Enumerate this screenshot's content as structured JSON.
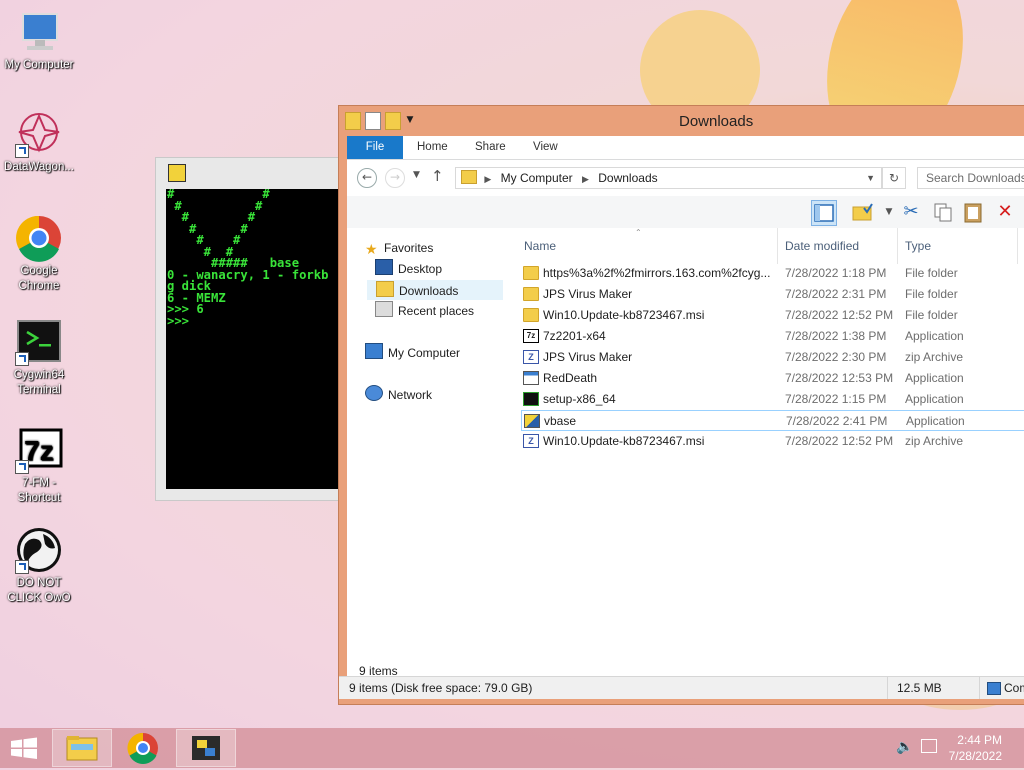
{
  "desktop": {
    "icons": [
      {
        "label": "My Computer",
        "icon": "computer-icon"
      },
      {
        "label": "DataWagon...",
        "icon": "datawagon-icon"
      },
      {
        "label": "Google Chrome",
        "icon": "chrome-icon"
      },
      {
        "label": "Cygwin64 Terminal",
        "icon": "terminal-icon"
      },
      {
        "label": "7-FM - Shortcut",
        "icon": "7zip-icon"
      },
      {
        "label": "DO NOT CLICK OwO",
        "icon": "globe-icon"
      }
    ]
  },
  "console": {
    "lines": [
      "#            #",
      " #          # ",
      "  #        #  ",
      "   #      #   ",
      "    #    #    ",
      "     #  #     ",
      "      #####   base",
      "0 - wanacry, 1 - forkb",
      "g dick",
      "6 - MEMZ",
      ">>> 6",
      ">>>"
    ]
  },
  "explorer": {
    "title": "Downloads",
    "ribbon_tabs": {
      "file": "File",
      "home": "Home",
      "share": "Share",
      "view": "View"
    },
    "address": {
      "root": "My Computer",
      "current": "Downloads"
    },
    "search_placeholder": "Search Downloads",
    "nav": {
      "favorites": "Favorites",
      "desktop": "Desktop",
      "downloads": "Downloads",
      "recent": "Recent places",
      "computer": "My Computer",
      "network": "Network"
    },
    "columns": {
      "name": "Name",
      "date": "Date modified",
      "type": "Type"
    },
    "files": [
      {
        "name": "https%3a%2f%2fmirrors.163.com%2fcyg...",
        "date": "7/28/2022 1:18 PM",
        "type": "File folder",
        "icon": "folder"
      },
      {
        "name": "JPS Virus Maker",
        "date": "7/28/2022 2:31 PM",
        "type": "File folder",
        "icon": "folder"
      },
      {
        "name": "Win10.Update-kb8723467.msi",
        "date": "7/28/2022 12:52 PM",
        "type": "File folder",
        "icon": "folder"
      },
      {
        "name": "7z2201-x64",
        "date": "7/28/2022 1:38 PM",
        "type": "Application",
        "icon": "7zip"
      },
      {
        "name": "JPS Virus Maker",
        "date": "7/28/2022 2:30 PM",
        "type": "zip Archive",
        "icon": "zip"
      },
      {
        "name": "RedDeath",
        "date": "7/28/2022 12:53 PM",
        "type": "Application",
        "icon": "app"
      },
      {
        "name": "setup-x86_64",
        "date": "7/28/2022 1:15 PM",
        "type": "Application",
        "icon": "cygwin"
      },
      {
        "name": "vbase",
        "date": "7/28/2022 2:41 PM",
        "type": "Application",
        "icon": "python"
      },
      {
        "name": "Win10.Update-kb8723467.msi",
        "date": "7/28/2022 12:52 PM",
        "type": "zip Archive",
        "icon": "zip"
      }
    ],
    "item_count": "9 items",
    "status": {
      "left": "9 items (Disk free space: 79.0 GB)",
      "size": "12.5 MB",
      "location": "Com"
    }
  },
  "taskbar": {
    "time": "2:44 PM",
    "date": "7/28/2022"
  },
  "colors": {
    "file_tab": "#1979ca",
    "window_frame": "#e9a07a",
    "console_text": "#39e339"
  }
}
